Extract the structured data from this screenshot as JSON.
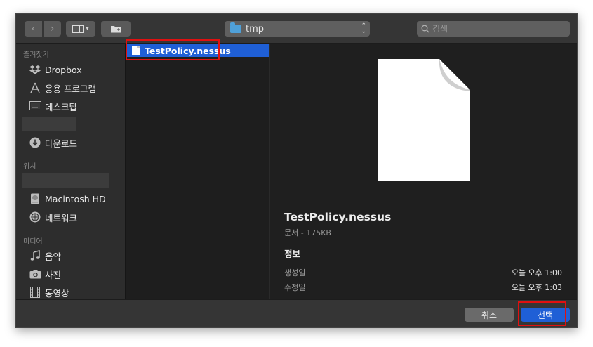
{
  "toolbar": {
    "path_label": "tmp",
    "search_placeholder": "검색"
  },
  "sidebar": {
    "favorites_header": "즐겨찾기",
    "favorites": [
      {
        "label": "Dropbox",
        "icon": "dropbox-icon"
      },
      {
        "label": "응용 프로그램",
        "icon": "applications-icon"
      },
      {
        "label": "데스크탑",
        "icon": "desktop-icon"
      },
      {
        "label": "다운로드",
        "icon": "downloads-icon"
      }
    ],
    "locations_header": "위치",
    "locations": [
      {
        "label": "Macintosh HD",
        "icon": "disk-icon"
      },
      {
        "label": "네트워크",
        "icon": "network-icon"
      }
    ],
    "media_header": "미디어",
    "media": [
      {
        "label": "음악",
        "icon": "music-icon"
      },
      {
        "label": "사진",
        "icon": "camera-icon"
      },
      {
        "label": "동영상",
        "icon": "film-icon"
      }
    ]
  },
  "file_list": {
    "selected_file": "TestPolicy.nessus"
  },
  "preview": {
    "name": "TestPolicy.nessus",
    "kind_size": "문서 - 175KB",
    "info_header": "정보",
    "rows": [
      {
        "key": "생성일",
        "value": "오늘 오후 1:00"
      },
      {
        "key": "수정일",
        "value": "오늘 오후 1:03"
      }
    ]
  },
  "footer": {
    "cancel_label": "취소",
    "confirm_label": "선택"
  },
  "colors": {
    "accent": "#1f5fd6",
    "highlight": "#e01010"
  }
}
